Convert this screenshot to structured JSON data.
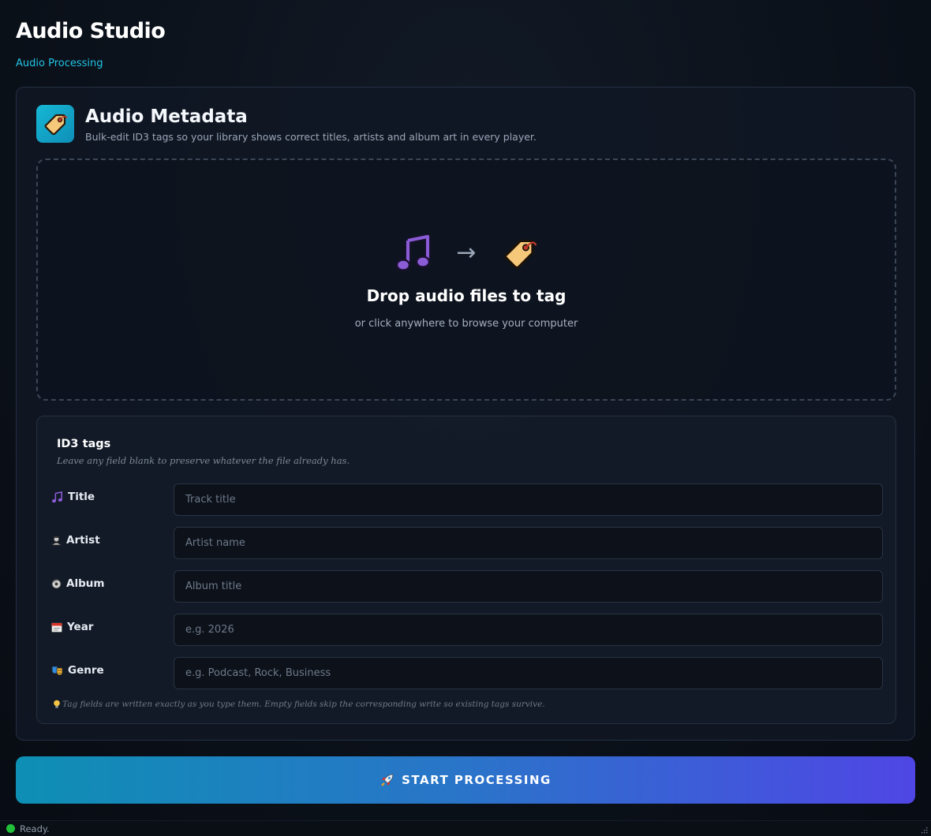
{
  "app": {
    "title": "Audio Studio",
    "breadcrumb": "Audio Processing"
  },
  "tool": {
    "title": "Audio Metadata",
    "description": "Bulk-edit ID3 tags so your library shows correct titles, artists and album art in every player.",
    "icon": "tag-icon"
  },
  "dropzone": {
    "title": "Drop audio files to tag",
    "subtitle": "or click anywhere to browse your computer",
    "icons": [
      "music-note-icon",
      "arrow-right-icon",
      "tag-icon"
    ],
    "arrow": "→"
  },
  "tags": {
    "title": "ID3 tags",
    "hint": "Leave any field blank to preserve whatever the file already has.",
    "fields": [
      {
        "label": "Title",
        "placeholder": "Track title",
        "value": "",
        "icon": "music-note-icon"
      },
      {
        "label": "Artist",
        "placeholder": "Artist name",
        "value": "",
        "icon": "artist-icon"
      },
      {
        "label": "Album",
        "placeholder": "Album title",
        "value": "",
        "icon": "disc-icon"
      },
      {
        "label": "Year",
        "placeholder": "e.g. 2026",
        "value": "",
        "icon": "calendar-icon"
      },
      {
        "label": "Genre",
        "placeholder": "e.g. Podcast, Rock, Business",
        "value": "",
        "icon": "theater-masks-icon"
      }
    ],
    "note": "Tag fields are written exactly as you type them. Empty fields skip the corresponding write so existing tags survive.",
    "note_icon": "lightbulb-icon"
  },
  "actions": {
    "start_label": "START PROCESSING",
    "start_icon": "rocket-icon"
  },
  "status": {
    "text": "Ready.",
    "color": "#22c03a"
  },
  "colors": {
    "accent": "#22c3e6",
    "button_start": "#0e8fb4",
    "button_end": "#4f46e5"
  }
}
